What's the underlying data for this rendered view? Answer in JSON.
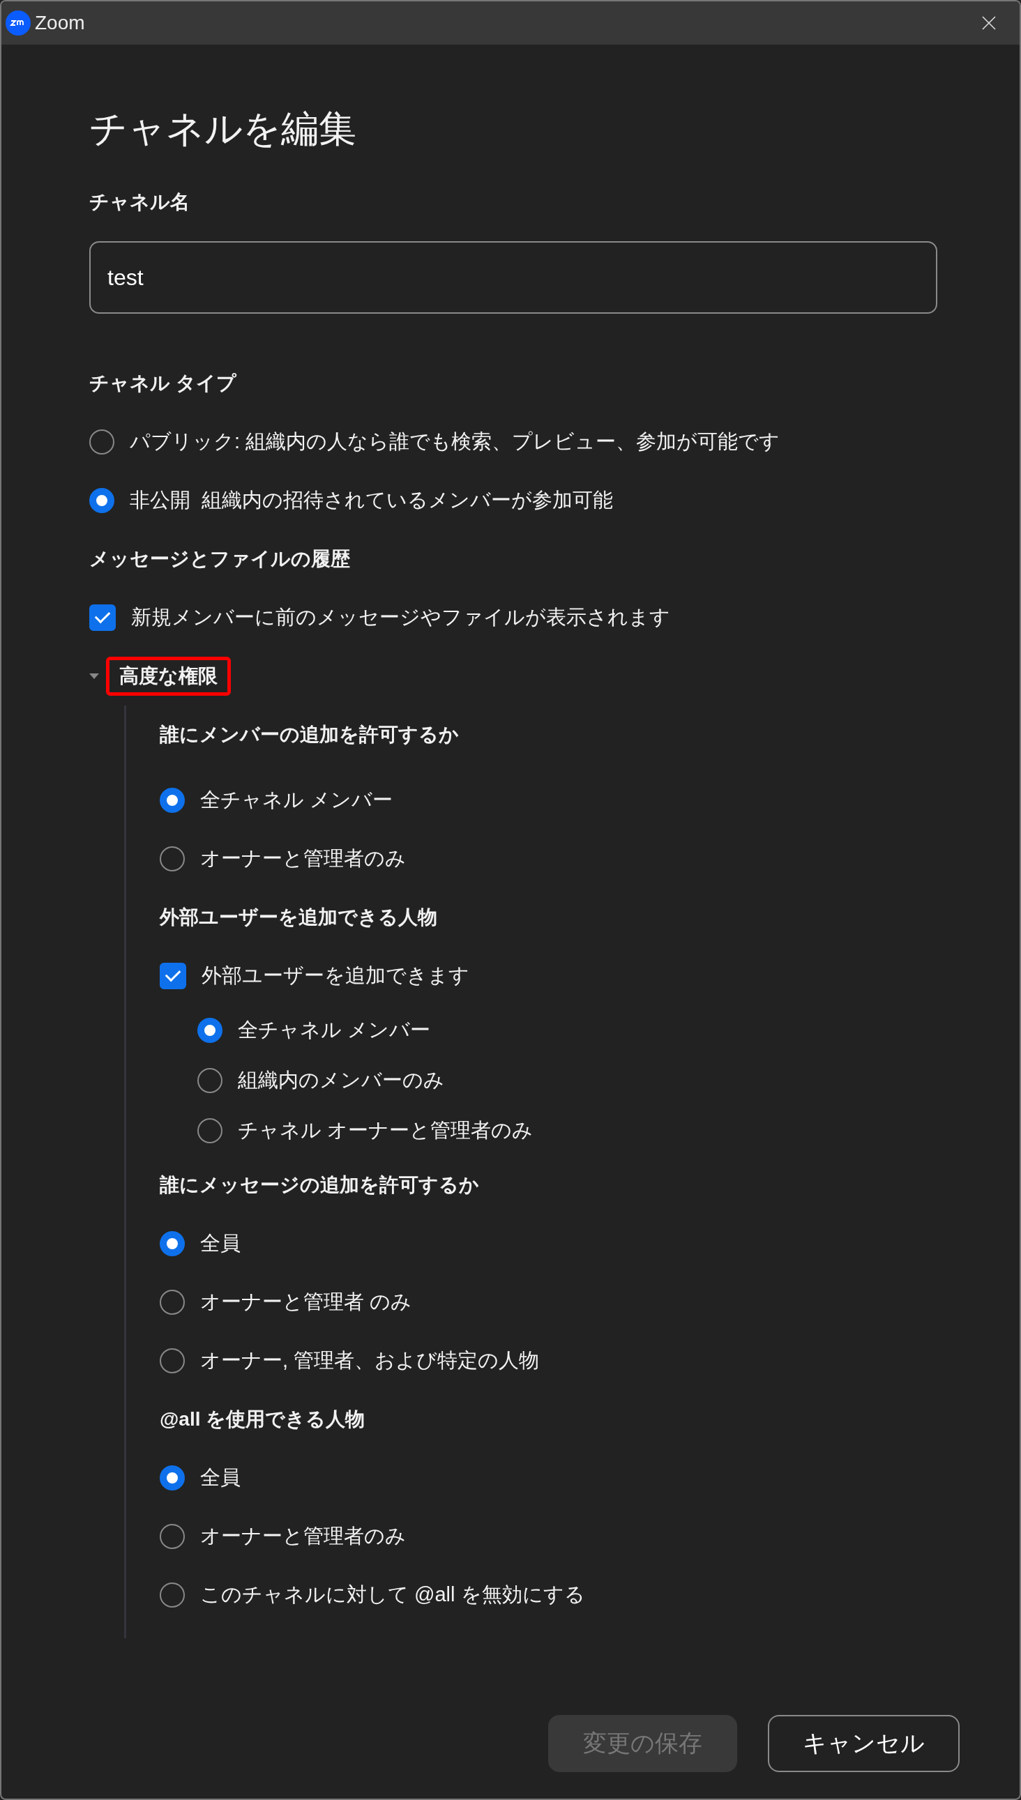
{
  "window": {
    "title": "Zoom"
  },
  "heading": "チャネルを編集",
  "channel_name": {
    "label": "チャネル名",
    "value": "test"
  },
  "sections": [
    {
      "title": "チャネル タイプ",
      "options": [
        {
          "kind": "radio",
          "label": "パブリック: 組織内の人なら誰でも検索、プレビュー、参加が可能です",
          "selected": false
        },
        {
          "kind": "radio",
          "label": "非公開  組織内の招待されているメンバーが参加可能",
          "selected": true
        }
      ]
    },
    {
      "title": "メッセージとファイルの履歴",
      "options": [
        {
          "kind": "checkbox",
          "label": "新規メンバーに前のメッセージやファイルが表示されます",
          "checked": true
        }
      ]
    }
  ],
  "advanced": {
    "label": "高度な権限",
    "expanded": true,
    "highlighted": true,
    "groups": [
      {
        "title": "誰にメンバーの追加を許可するか",
        "options": [
          {
            "kind": "radio",
            "label": "全チャネル メンバー",
            "selected": true
          },
          {
            "kind": "radio",
            "label": "オーナーと管理者のみ",
            "selected": false
          }
        ]
      },
      {
        "title": "外部ユーザーを追加できる人物",
        "options": [
          {
            "kind": "checkbox",
            "label": "外部ユーザーを追加できます",
            "checked": true,
            "children": [
              {
                "kind": "radio",
                "label": "全チャネル メンバー",
                "selected": true
              },
              {
                "kind": "radio",
                "label": "組織内のメンバーのみ",
                "selected": false
              },
              {
                "kind": "radio",
                "label": "チャネル オーナーと管理者のみ",
                "selected": false
              }
            ]
          }
        ]
      },
      {
        "title": "誰にメッセージの追加を許可するか",
        "options": [
          {
            "kind": "radio",
            "label": "全員",
            "selected": true
          },
          {
            "kind": "radio",
            "label": "オーナーと管理者 のみ",
            "selected": false
          },
          {
            "kind": "radio",
            "label": "オーナー, 管理者、および特定の人物",
            "selected": false
          }
        ]
      },
      {
        "title": "@all を使用できる人物",
        "options": [
          {
            "kind": "radio",
            "label": "全員",
            "selected": true
          },
          {
            "kind": "radio",
            "label": "オーナーと管理者のみ",
            "selected": false
          },
          {
            "kind": "radio",
            "label": "このチャネルに対して @all を無効にする",
            "selected": false
          }
        ]
      }
    ]
  },
  "buttons": [
    {
      "kind": "primary",
      "label": "変更の保存",
      "disabled": true
    },
    {
      "kind": "secondary",
      "label": "キャンセル",
      "disabled": false
    }
  ]
}
